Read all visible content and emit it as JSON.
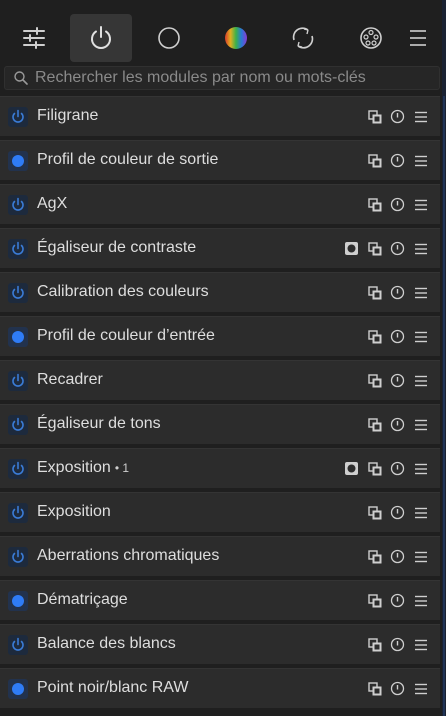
{
  "colors": {
    "accent": "#3a7bd5",
    "power_on": "#2f7cf6",
    "icon_gray": "#cfcfcf",
    "background": "#1f1f1f",
    "row": "#2c2c2c"
  },
  "tabs": [
    {
      "name": "sliders-icon",
      "active": false
    },
    {
      "name": "power-icon",
      "active": true
    },
    {
      "name": "circle-icon",
      "active": false
    },
    {
      "name": "color-wheel-icon",
      "active": false
    },
    {
      "name": "rotate-arrows-icon",
      "active": false
    },
    {
      "name": "film-reel-icon",
      "active": false
    },
    {
      "name": "hamburger-menu-icon",
      "active": false
    }
  ],
  "search": {
    "placeholder": "Rechercher les modules par nom ou mots-clés"
  },
  "modules": [
    {
      "name": "Filigrane",
      "instance": "",
      "enabled": false,
      "mask": false
    },
    {
      "name": "Profil de couleur de sortie",
      "instance": "",
      "enabled": true,
      "mask": false
    },
    {
      "name": "AgX",
      "instance": "",
      "enabled": false,
      "mask": false
    },
    {
      "name": "Égaliseur de contraste",
      "instance": "",
      "enabled": false,
      "mask": true
    },
    {
      "name": "Calibration des couleurs",
      "instance": "",
      "enabled": false,
      "mask": false
    },
    {
      "name": "Profil de couleur d’entrée",
      "instance": "",
      "enabled": true,
      "mask": false
    },
    {
      "name": "Recadrer",
      "instance": "",
      "enabled": false,
      "mask": false
    },
    {
      "name": "Égaliseur de tons",
      "instance": "",
      "enabled": false,
      "mask": false
    },
    {
      "name": "Exposition",
      "instance": "• 1",
      "enabled": false,
      "mask": true
    },
    {
      "name": "Exposition",
      "instance": "",
      "enabled": false,
      "mask": false
    },
    {
      "name": "Aberrations chromatiques",
      "instance": "",
      "enabled": false,
      "mask": false
    },
    {
      "name": "Dématriçage",
      "instance": "",
      "enabled": true,
      "mask": false
    },
    {
      "name": "Balance des blancs",
      "instance": "",
      "enabled": false,
      "mask": false
    },
    {
      "name": "Point noir/blanc RAW",
      "instance": "",
      "enabled": true,
      "mask": false
    }
  ]
}
